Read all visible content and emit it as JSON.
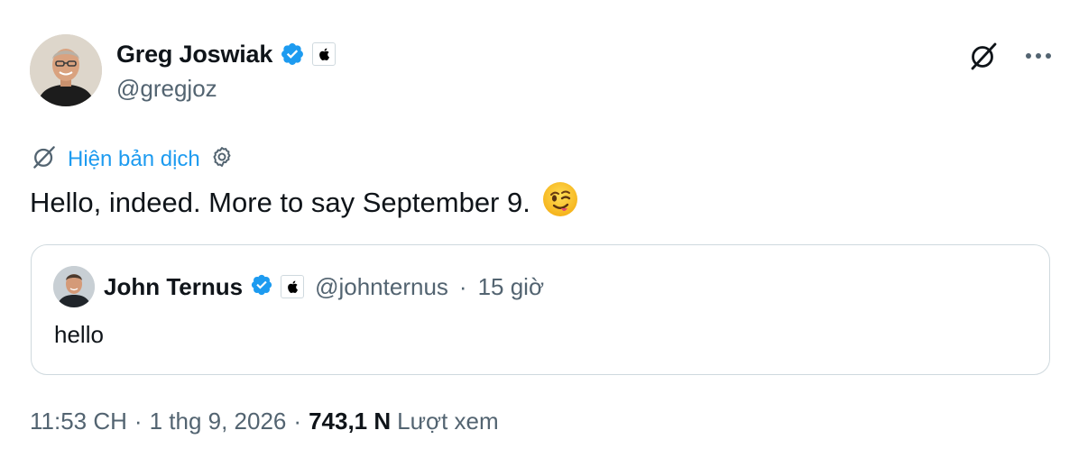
{
  "author": {
    "name": "Greg Joswiak",
    "handle": "@gregjoz"
  },
  "translate": {
    "label": "Hiện bản dịch"
  },
  "tweet": {
    "text": "Hello, indeed. More to say September 9.",
    "emoji": "wink-emoji"
  },
  "quoted": {
    "name": "John Ternus",
    "handle": "@johnternus",
    "separator": "·",
    "time": "15 giờ",
    "text": "hello"
  },
  "meta": {
    "time": "11:53 CH",
    "date": "1 thg 9, 2026",
    "views_count": "743,1 N",
    "views_label": "Lượt xem",
    "separator": "·"
  },
  "colors": {
    "accent": "#1d9bf0",
    "secondary_text": "#536471",
    "border": "#cfd9de"
  },
  "icons": [
    "verified-badge-icon",
    "apple-affiliate-icon",
    "grok-icon",
    "more-icon",
    "settings-gear-icon"
  ]
}
